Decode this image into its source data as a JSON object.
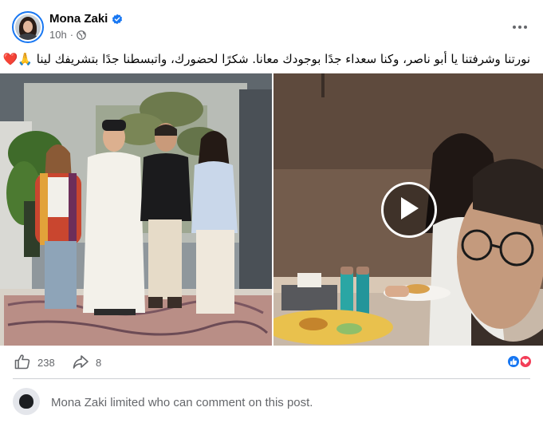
{
  "post": {
    "author": "Mona Zaki",
    "verified": true,
    "time": "10h",
    "separator": "·",
    "audience_icon": "globe-icon",
    "more_icon": "more-options-icon",
    "text": "نورتنا وشرفتنا يا أبو ناصر، وكنا سعداء جدًا بوجودك معانا. شكرًا لحضورك، واتبسطنا جدًا بتشريفك لينا 🙏❤️"
  },
  "media": {
    "photo_icon": "group-photo",
    "video_icon": "play-icon"
  },
  "engagement": {
    "likes": "238",
    "shares": "8",
    "reactions": [
      "like",
      "love"
    ]
  },
  "comments": {
    "notice": "Mona Zaki limited who can comment on this post."
  },
  "colors": {
    "accent": "#1877f2",
    "love": "#f33e58",
    "secondary_text": "#65676b"
  }
}
